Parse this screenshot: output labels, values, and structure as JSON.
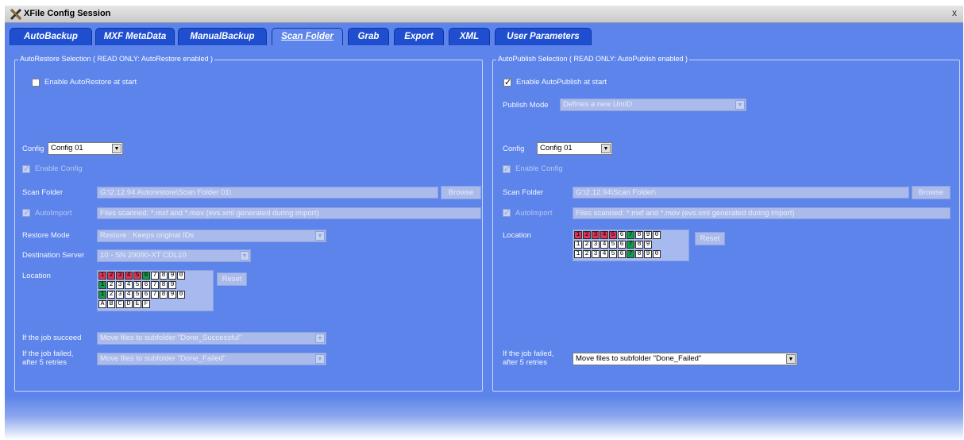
{
  "window": {
    "title": "XFile Config Session",
    "close_label": "x"
  },
  "tabs": [
    {
      "label": "AutoBackup",
      "active": false
    },
    {
      "label": "MXF MetaData",
      "active": false
    },
    {
      "label": "ManualBackup",
      "active": false
    },
    {
      "label": "Scan Folder",
      "active": true
    },
    {
      "label": "Grab",
      "active": false
    },
    {
      "label": "Export",
      "active": false
    },
    {
      "label": "XML",
      "active": false
    },
    {
      "label": "User Parameters",
      "active": false
    }
  ],
  "restore": {
    "legend": "AutoRestore Selection ( READ ONLY: AutoRestore enabled )",
    "enable_label": "Enable AutoRestore at start",
    "enable_checked": false,
    "config_label": "Config",
    "config_value": "Config 01",
    "enable_config_label": "Enable Config",
    "scan_folder_label": "Scan Folder",
    "scan_folder_value": "G:\\2.12.94 Autorestore\\Scan Folder 01\\",
    "browse_label": "Browse",
    "autoimport_label": "AutoImport",
    "autoimport_value": "Files scanned: *.mxf and *.mov (evs.xml generated during import)",
    "restore_mode_label": "Restore Mode",
    "restore_mode_value": "Restore : Keeps original IDs",
    "dest_server_label": "Destination Server",
    "dest_server_value": "10 - SN 29090-XT CDL10",
    "location_label": "Location",
    "reset_label": "Reset",
    "succeed_label": "If the job succeed",
    "succeed_value": "Move files to subfolder \"Done_Successful\"",
    "failed_label_1": "If the job failed,",
    "failed_label_2": "after 5 retries",
    "failed_value": "Move files to subfolder \"Done_Failed\"",
    "location_grid": [
      [
        {
          "t": "1",
          "c": "red"
        },
        {
          "t": "2",
          "c": "red"
        },
        {
          "t": "3",
          "c": "red"
        },
        {
          "t": "4",
          "c": "red"
        },
        {
          "t": "5",
          "c": "red"
        },
        {
          "t": "6",
          "c": "green"
        },
        {
          "t": "7",
          "c": ""
        },
        {
          "t": "8",
          "c": ""
        },
        {
          "t": "9",
          "c": ""
        },
        {
          "t": "0",
          "c": ""
        }
      ],
      [
        {
          "t": "1",
          "c": "green"
        },
        {
          "t": "2",
          "c": ""
        },
        {
          "t": "3",
          "c": ""
        },
        {
          "t": "4",
          "c": ""
        },
        {
          "t": "5",
          "c": ""
        },
        {
          "t": "6",
          "c": ""
        },
        {
          "t": "7",
          "c": ""
        },
        {
          "t": "8",
          "c": ""
        },
        {
          "t": "9",
          "c": ""
        }
      ],
      [
        {
          "t": "1",
          "c": "green"
        },
        {
          "t": "2",
          "c": ""
        },
        {
          "t": "3",
          "c": ""
        },
        {
          "t": "4",
          "c": ""
        },
        {
          "t": "5",
          "c": ""
        },
        {
          "t": "6",
          "c": ""
        },
        {
          "t": "7",
          "c": ""
        },
        {
          "t": "8",
          "c": ""
        },
        {
          "t": "9",
          "c": ""
        },
        {
          "t": "0",
          "c": ""
        }
      ],
      [
        {
          "t": "A",
          "c": ""
        },
        {
          "t": "B",
          "c": ""
        },
        {
          "t": "C",
          "c": ""
        },
        {
          "t": "D",
          "c": ""
        },
        {
          "t": "E",
          "c": ""
        },
        {
          "t": "F",
          "c": ""
        }
      ]
    ]
  },
  "publish": {
    "legend": "AutoPublish Selection ( READ ONLY: AutoPublish enabled )",
    "enable_label": "Enable AutoPublish at start",
    "enable_checked": true,
    "publish_mode_label": "Publish Mode",
    "publish_mode_value": "Defines a new UmID",
    "config_label": "Config",
    "config_value": "Config 01",
    "enable_config_label": "Enable Config",
    "scan_folder_label": "Scan Folder",
    "scan_folder_value": "G:\\2.12.94\\Scan Folder\\",
    "browse_label": "Browse",
    "autoimport_label": "AutoImport",
    "autoimport_value": "Files scanned: *.mxf and *.mov (evs.xml generated during import)",
    "location_label": "Location",
    "reset_label": "Reset",
    "failed_label_1": "If the job failed,",
    "failed_label_2": "after 5 retries",
    "failed_value": "Move files to subfolder \"Done_Failed\"",
    "location_grid": [
      [
        {
          "t": "1",
          "c": "red"
        },
        {
          "t": "2",
          "c": "red"
        },
        {
          "t": "3",
          "c": "red"
        },
        {
          "t": "4",
          "c": "red"
        },
        {
          "t": "5",
          "c": "red"
        },
        {
          "t": "6",
          "c": ""
        },
        {
          "t": "7",
          "c": "green"
        },
        {
          "t": "8",
          "c": ""
        },
        {
          "t": "9",
          "c": ""
        },
        {
          "t": "0",
          "c": ""
        }
      ],
      [
        {
          "t": "1",
          "c": ""
        },
        {
          "t": "2",
          "c": ""
        },
        {
          "t": "3",
          "c": ""
        },
        {
          "t": "4",
          "c": ""
        },
        {
          "t": "5",
          "c": ""
        },
        {
          "t": "6",
          "c": ""
        },
        {
          "t": "7",
          "c": "green"
        },
        {
          "t": "8",
          "c": ""
        },
        {
          "t": "9",
          "c": ""
        }
      ],
      [
        {
          "t": "1",
          "c": ""
        },
        {
          "t": "2",
          "c": ""
        },
        {
          "t": "3",
          "c": ""
        },
        {
          "t": "4",
          "c": ""
        },
        {
          "t": "5",
          "c": ""
        },
        {
          "t": "6",
          "c": ""
        },
        {
          "t": "7",
          "c": "green"
        },
        {
          "t": "8",
          "c": ""
        },
        {
          "t": "9",
          "c": ""
        },
        {
          "t": "0",
          "c": ""
        }
      ]
    ]
  },
  "colors": {
    "panel_bg": "#5c84ea",
    "tab_bg": "#1f4fcf",
    "location_red": "#e0345a",
    "location_green": "#10a04a"
  }
}
